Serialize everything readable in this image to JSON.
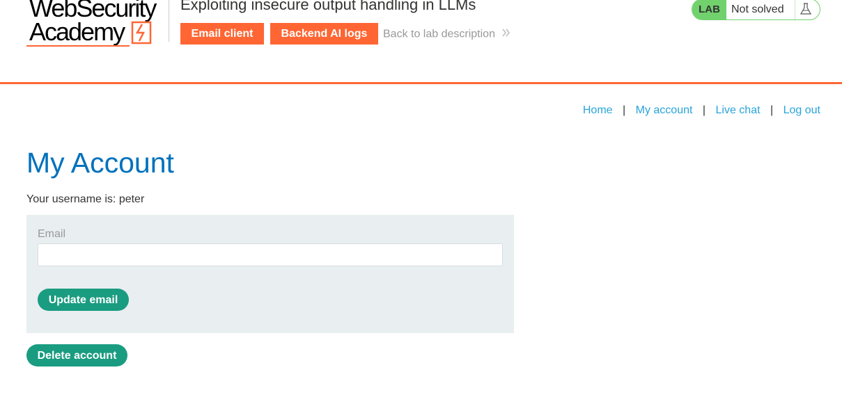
{
  "logo": {
    "line1": "WebSecurity",
    "line2": "Academy",
    "bolt_icon": "lightning-bolt-icon"
  },
  "header": {
    "lab_title": "Exploiting insecure output handling in LLMs",
    "buttons": {
      "email_client": "Email client",
      "backend_logs": "Backend AI logs"
    },
    "back_link": "Back to lab description",
    "back_icon": "double-chevron-right-icon"
  },
  "status": {
    "lab_label": "LAB",
    "state": "Not solved",
    "icon": "flask-icon"
  },
  "nav": {
    "items": [
      "Home",
      "My account",
      "Live chat",
      "Log out"
    ],
    "separator": "|"
  },
  "main": {
    "title": "My Account",
    "username_line": "Your username is: peter",
    "form": {
      "email_label": "Email",
      "email_value": "",
      "update_button": "Update email"
    },
    "delete_button": "Delete account"
  },
  "colors": {
    "accent_orange": "#ff6633",
    "link_blue": "#29a4d9",
    "title_blue": "#0071bc",
    "button_green": "#1a9c81",
    "lab_green": "#70d16d",
    "form_bg": "#e9eef1"
  }
}
